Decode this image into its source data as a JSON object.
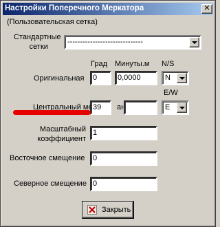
{
  "window": {
    "title": "Настройки Поперечного Меркатора",
    "close_glyph": "✕"
  },
  "subtitle": "(Пользовательская сетка)",
  "standard_grids": {
    "label_line1": "Стандартные",
    "label_line2": "сетки",
    "value": "------------------------------"
  },
  "columns": {
    "deg": "Град",
    "minutes": "Минуты.м",
    "ns": "N/S",
    "ew": "E/W"
  },
  "original": {
    "label": "Оригинальная",
    "deg": "0",
    "minutes": "0,0000",
    "hemisphere": "N"
  },
  "central_meridian": {
    "label": "Центральный ме",
    "label_tail": "ан",
    "deg": "39",
    "minutes": "",
    "hemisphere": "E"
  },
  "scale": {
    "label_line1": "Масштабный",
    "label_line2": "коэффициент",
    "value": "1"
  },
  "false_easting": {
    "label": "Восточное смещение",
    "value": "0"
  },
  "false_northing": {
    "label": "Северное смещение",
    "value": "0"
  },
  "close_button": {
    "label": "Закрыть",
    "icon": "close-x-icon"
  },
  "colors": {
    "title_start": "#0a246a",
    "title_end": "#a6caf0",
    "face": "#d4d0c8",
    "highlight": "#e60000"
  }
}
